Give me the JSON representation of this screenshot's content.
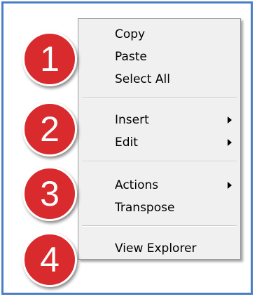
{
  "menu": {
    "items": [
      {
        "label": "Copy",
        "has_submenu": false
      },
      {
        "label": "Paste",
        "has_submenu": false
      },
      {
        "label": "Select All",
        "has_submenu": false
      },
      {
        "label": "Insert",
        "has_submenu": true
      },
      {
        "label": "Edit",
        "has_submenu": true
      },
      {
        "label": "Actions",
        "has_submenu": true
      },
      {
        "label": "Transpose",
        "has_submenu": false
      },
      {
        "label": "View Explorer",
        "has_submenu": false
      }
    ]
  },
  "callouts": [
    "1",
    "2",
    "3",
    "4"
  ],
  "colors": {
    "frame_border": "#4a7fc4",
    "menu_background": "#f0f0f0",
    "badge_fill": "#d92b2e",
    "badge_text": "#ffffff"
  },
  "icons": {
    "submenu_arrow": "submenu-arrow-icon"
  }
}
